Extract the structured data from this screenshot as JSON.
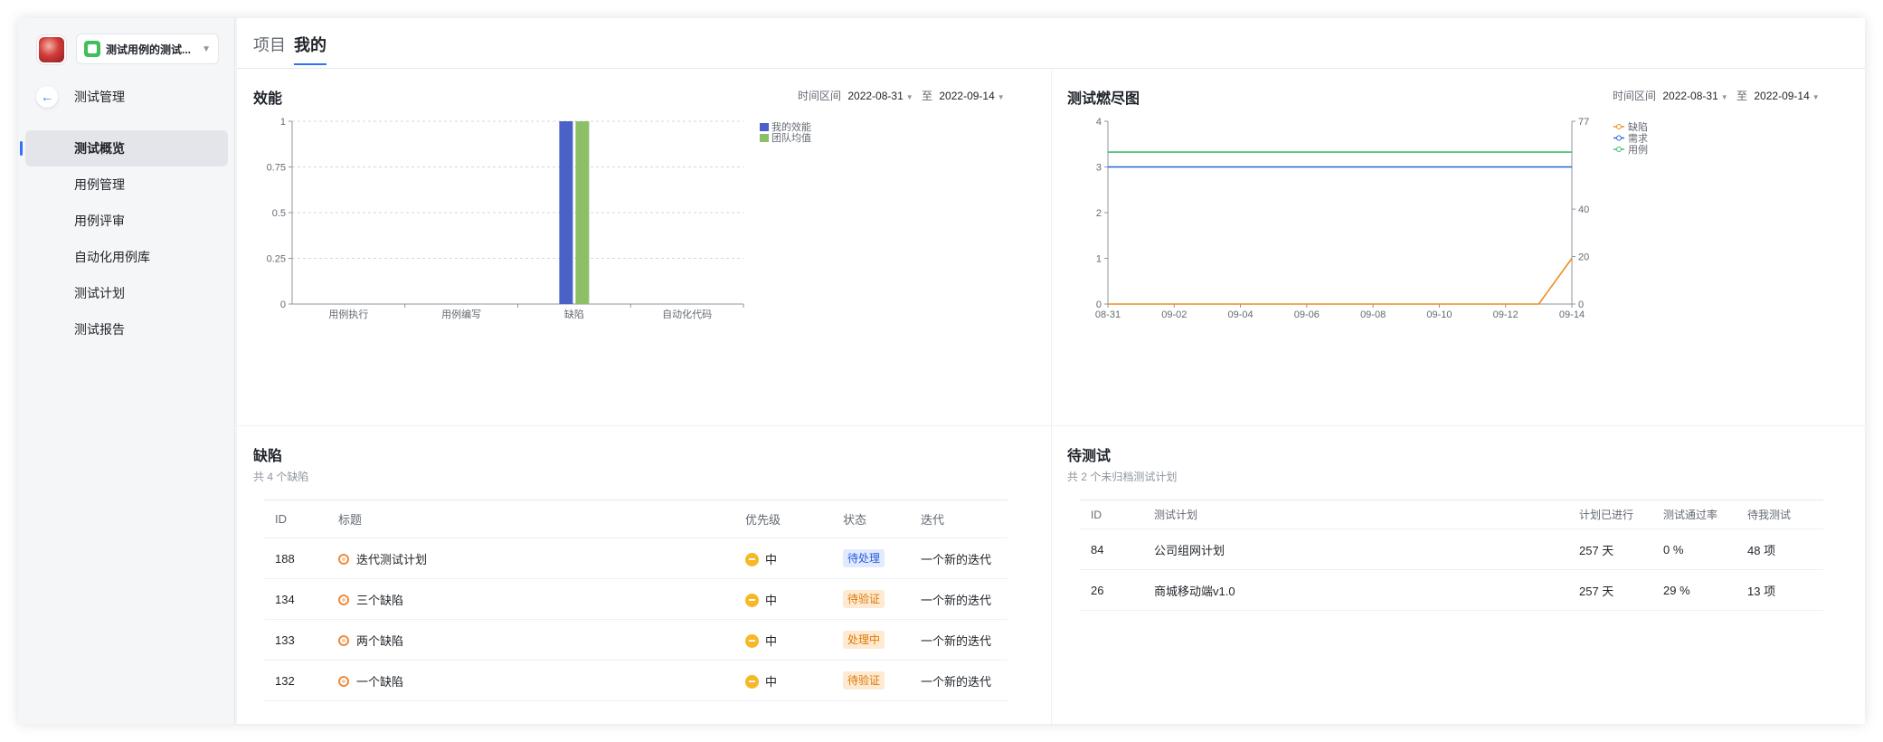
{
  "sidebar": {
    "project_name": "测试用例的测试...",
    "section_title": "测试管理",
    "items": [
      {
        "label": "测试概览",
        "active": true
      },
      {
        "label": "用例管理"
      },
      {
        "label": "用例评审"
      },
      {
        "label": "自动化用例库"
      },
      {
        "label": "测试计划"
      },
      {
        "label": "测试报告"
      }
    ]
  },
  "tabs": [
    {
      "label": "项目"
    },
    {
      "label": "我的",
      "active": true
    }
  ],
  "efficiency": {
    "title": "效能",
    "range_label": "时间区间",
    "range_start": "2022-08-31",
    "range_sep": "至",
    "range_end": "2022-09-14"
  },
  "burndown": {
    "title": "测试燃尽图",
    "range_label": "时间区间",
    "range_start": "2022-08-31",
    "range_sep": "至",
    "range_end": "2022-09-14"
  },
  "chart_data": [
    {
      "type": "bar",
      "title": "效能",
      "categories": [
        "用例执行",
        "用例编写",
        "缺陷",
        "自动化代码"
      ],
      "series": [
        {
          "name": "我的效能",
          "values": [
            0,
            0,
            1,
            0
          ],
          "color": "#4a62c8"
        },
        {
          "name": "团队均值",
          "values": [
            0,
            0,
            1,
            0
          ],
          "color": "#8cbf66"
        }
      ],
      "ylim": [
        0,
        1
      ],
      "yticks": [
        "0",
        "0.25",
        "0.5",
        "0.75",
        "1"
      ],
      "grid": true,
      "legend": "top-right"
    },
    {
      "type": "line",
      "title": "测试燃尽图",
      "x": [
        "08-31",
        "09-01",
        "09-02",
        "09-03",
        "09-04",
        "09-05",
        "09-06",
        "09-07",
        "09-08",
        "09-09",
        "09-10",
        "09-11",
        "09-12",
        "09-13",
        "09-14"
      ],
      "xticks": [
        "08-31",
        "09-02",
        "09-04",
        "09-06",
        "09-08",
        "09-10",
        "09-12",
        "09-14"
      ],
      "yticks_left": [
        "0",
        "1",
        "2",
        "3",
        "4"
      ],
      "yticks_right": [
        "0",
        "20",
        "40",
        "77"
      ],
      "ylim_left": [
        0,
        4
      ],
      "series": [
        {
          "name": "缺陷",
          "axis": "left",
          "color": "#f08c1c",
          "values": [
            0,
            0,
            0,
            0,
            0,
            0,
            0,
            0,
            0,
            0,
            0,
            0,
            0,
            0,
            1
          ]
        },
        {
          "name": "需求",
          "axis": "left",
          "color": "#2266d4",
          "values": [
            3,
            3,
            3,
            3,
            3,
            3,
            3,
            3,
            3,
            3,
            3,
            3,
            3,
            3,
            3
          ]
        },
        {
          "name": "用例",
          "axis": "right",
          "color": "#3cbf6a",
          "values": [
            64,
            64,
            64,
            64,
            64,
            64,
            64,
            64,
            64,
            64,
            64,
            64,
            64,
            64,
            64
          ]
        }
      ],
      "legend": "top-right"
    }
  ],
  "bugs": {
    "title": "缺陷",
    "subtitle": "共 4 个缺陷",
    "headers": [
      "ID",
      "标题",
      "优先级",
      "状态",
      "迭代"
    ],
    "rows": [
      {
        "id": "188",
        "title": "迭代测试计划",
        "priority": "中",
        "status": "待处理",
        "status_color": "blue",
        "iteration": "一个新的迭代"
      },
      {
        "id": "134",
        "title": "三个缺陷",
        "priority": "中",
        "status": "待验证",
        "status_color": "orange",
        "iteration": "一个新的迭代"
      },
      {
        "id": "133",
        "title": "两个缺陷",
        "priority": "中",
        "status": "处理中",
        "status_color": "orange",
        "iteration": "一个新的迭代"
      },
      {
        "id": "132",
        "title": "一个缺陷",
        "priority": "中",
        "status": "待验证",
        "status_color": "orange",
        "iteration": "一个新的迭代"
      }
    ]
  },
  "pending": {
    "title": "待测试",
    "subtitle": "共 2 个未归档测试计划",
    "headers": [
      "ID",
      "测试计划",
      "计划已进行",
      "测试通过率",
      "待我测试"
    ],
    "rows": [
      {
        "id": "84",
        "plan": "公司组网计划",
        "elapsed": "257 天",
        "pass_rate": "0 %",
        "mine": "48 项"
      },
      {
        "id": "26",
        "plan": "商城移动端v1.0",
        "elapsed": "257 天",
        "pass_rate": "29 %",
        "mine": "13 项"
      }
    ]
  }
}
